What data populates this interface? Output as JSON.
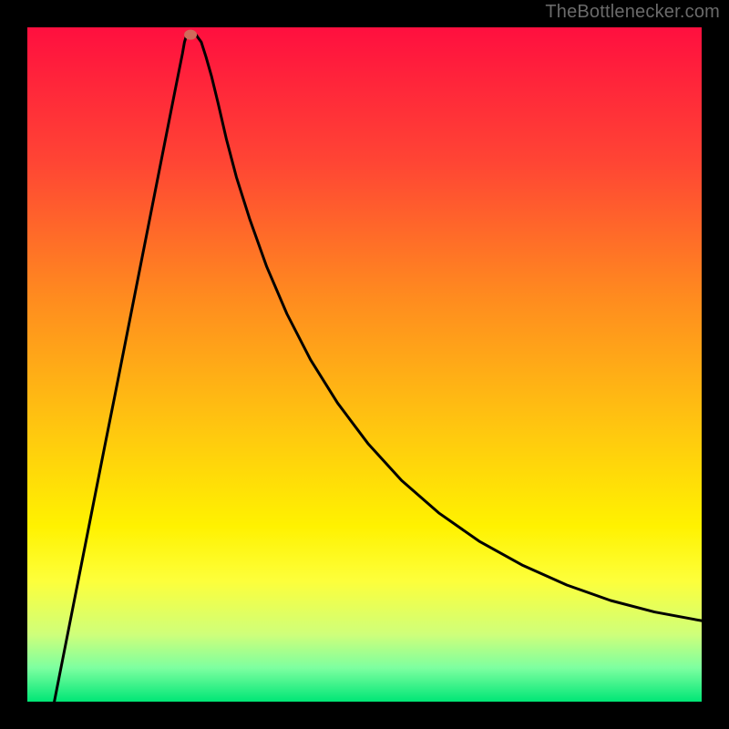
{
  "watermark": "TheBottlenecker.com",
  "chart_data": {
    "type": "line",
    "title": "",
    "xlabel": "",
    "ylabel": "",
    "xlim": [
      0,
      100
    ],
    "ylim": [
      0,
      100
    ],
    "gradient_stops": [
      {
        "offset": 0,
        "color": "#ff0f3f"
      },
      {
        "offset": 20,
        "color": "#ff4534"
      },
      {
        "offset": 40,
        "color": "#ff8b1f"
      },
      {
        "offset": 60,
        "color": "#ffc80f"
      },
      {
        "offset": 74,
        "color": "#fff200"
      },
      {
        "offset": 82,
        "color": "#fdff3a"
      },
      {
        "offset": 90,
        "color": "#cfff7a"
      },
      {
        "offset": 95,
        "color": "#7dffa0"
      },
      {
        "offset": 100,
        "color": "#00e676"
      }
    ],
    "marker": {
      "x": 24.2,
      "y": 98.9,
      "color": "#cf6a5a"
    },
    "curve": [
      {
        "x": 4.0,
        "y": 0.0
      },
      {
        "x": 5.5,
        "y": 7.6
      },
      {
        "x": 7.0,
        "y": 15.2
      },
      {
        "x": 8.5,
        "y": 22.8
      },
      {
        "x": 10.0,
        "y": 30.4
      },
      {
        "x": 11.5,
        "y": 38.0
      },
      {
        "x": 13.0,
        "y": 45.5
      },
      {
        "x": 14.5,
        "y": 53.1
      },
      {
        "x": 16.0,
        "y": 60.7
      },
      {
        "x": 17.5,
        "y": 68.3
      },
      {
        "x": 19.0,
        "y": 75.9
      },
      {
        "x": 20.5,
        "y": 83.5
      },
      {
        "x": 22.0,
        "y": 91.1
      },
      {
        "x": 23.0,
        "y": 96.1
      },
      {
        "x": 23.3,
        "y": 97.8
      },
      {
        "x": 23.6,
        "y": 98.8
      },
      {
        "x": 24.2,
        "y": 99.0
      },
      {
        "x": 25.0,
        "y": 98.9
      },
      {
        "x": 25.8,
        "y": 97.8
      },
      {
        "x": 26.5,
        "y": 95.6
      },
      {
        "x": 27.3,
        "y": 92.8
      },
      {
        "x": 28.3,
        "y": 88.7
      },
      {
        "x": 29.5,
        "y": 83.5
      },
      {
        "x": 31.0,
        "y": 77.8
      },
      {
        "x": 33.0,
        "y": 71.5
      },
      {
        "x": 35.5,
        "y": 64.5
      },
      {
        "x": 38.5,
        "y": 57.5
      },
      {
        "x": 42.0,
        "y": 50.7
      },
      {
        "x": 46.0,
        "y": 44.3
      },
      {
        "x": 50.5,
        "y": 38.3
      },
      {
        "x": 55.5,
        "y": 32.8
      },
      {
        "x": 61.0,
        "y": 28.0
      },
      {
        "x": 67.0,
        "y": 23.8
      },
      {
        "x": 73.5,
        "y": 20.2
      },
      {
        "x": 80.0,
        "y": 17.3
      },
      {
        "x": 86.5,
        "y": 15.0
      },
      {
        "x": 93.0,
        "y": 13.3
      },
      {
        "x": 100.0,
        "y": 12.0
      }
    ]
  }
}
